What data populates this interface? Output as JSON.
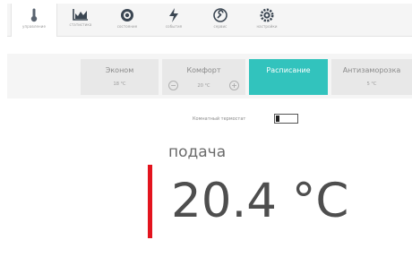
{
  "nav": {
    "items": [
      {
        "icon": "thermometer-icon",
        "label": "управление",
        "active": true
      },
      {
        "icon": "statistics-chart-icon",
        "label": "статистика",
        "active": false
      },
      {
        "icon": "state-disc-icon",
        "label": "состояние",
        "active": false
      },
      {
        "icon": "lightning-icon",
        "label": "события",
        "active": false
      },
      {
        "icon": "wrench-icon",
        "label": "сервис",
        "active": false
      },
      {
        "icon": "gear-icon",
        "label": "настройки",
        "active": false
      }
    ]
  },
  "modes": [
    {
      "name": "Эконом",
      "temp": "18 °C",
      "active": false
    },
    {
      "name": "Комфорт",
      "temp": "20 °C",
      "active": false,
      "decrease": "−",
      "increase": "+"
    },
    {
      "name": "Расписание",
      "active": true
    },
    {
      "name": "Антизаморозка",
      "temp": "5 °C",
      "active": false
    }
  ],
  "thermostat": {
    "label": "Комнатный термостат",
    "enabled": false
  },
  "supply": {
    "label": "подача",
    "temp": "20.4 °C"
  },
  "colors": {
    "accent": "#32c3bd",
    "supply_bar": "#e3141e",
    "toggle_border": "#555555"
  }
}
